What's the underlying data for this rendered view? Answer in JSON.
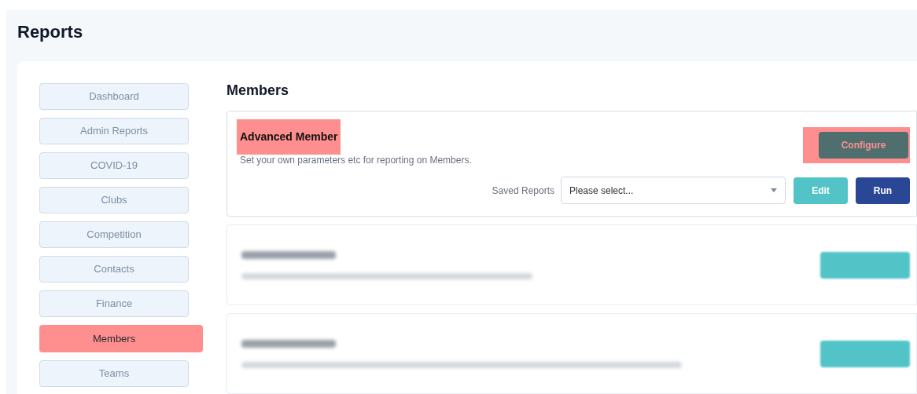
{
  "page_title": "Reports",
  "sidebar": {
    "items": [
      {
        "label": "Dashboard",
        "selected": false
      },
      {
        "label": "Admin Reports",
        "selected": false
      },
      {
        "label": "COVID-19",
        "selected": false
      },
      {
        "label": "Clubs",
        "selected": false
      },
      {
        "label": "Competition",
        "selected": false
      },
      {
        "label": "Contacts",
        "selected": false
      },
      {
        "label": "Finance",
        "selected": false
      },
      {
        "label": "Members",
        "selected": true
      },
      {
        "label": "Teams",
        "selected": false
      }
    ]
  },
  "section_title": "Members",
  "reports": [
    {
      "title": "Advanced Member",
      "description": "Set your own parameters etc for reporting on Members.",
      "configure": "Configure",
      "highlighted": true,
      "blurred": false,
      "saved_reports": {
        "label": "Saved Reports",
        "placeholder": "Please select...",
        "edit": "Edit",
        "run": "Run"
      }
    },
    {
      "blurred": true
    },
    {
      "blurred": true
    }
  ]
}
